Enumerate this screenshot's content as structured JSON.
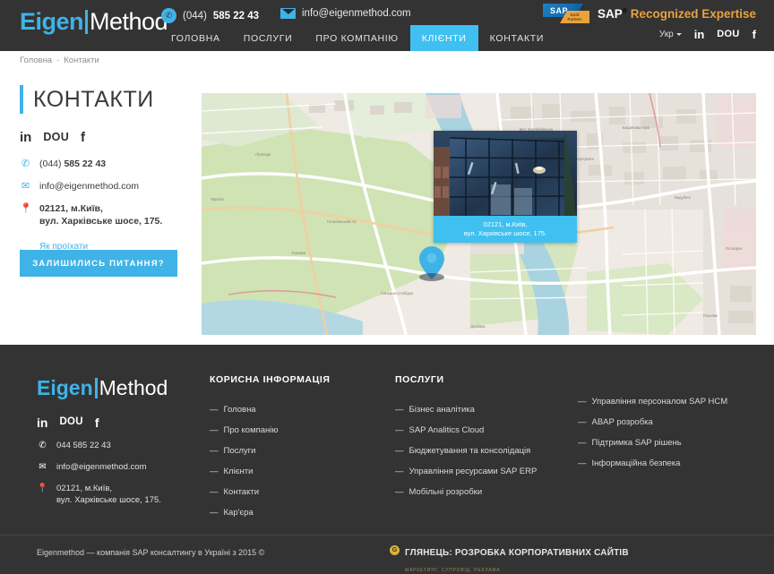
{
  "header": {
    "logo": {
      "part1": "Eigen",
      "part2": "Method"
    },
    "phone": {
      "icon": "phone-icon",
      "prefix": "(044)",
      "number": "585 22 43"
    },
    "email": {
      "icon": "mail-icon",
      "value": "info@eigenmethod.com"
    },
    "nav": [
      {
        "label": "ГОЛОВНА",
        "active": false
      },
      {
        "label": "ПОСЛУГИ",
        "active": false
      },
      {
        "label": "ПРО КОМПАНІЮ",
        "active": false
      },
      {
        "label": "КЛІЄНТИ",
        "active": true
      },
      {
        "label": "КОНТАКТИ",
        "active": false
      }
    ],
    "sap_badge": {
      "logo_text": "SAP",
      "ribbon_line1": "Gold",
      "ribbon_line2": "Partner",
      "text_white": "SAP",
      "text_sup": "®",
      "text_gold": "Recognized Expertise"
    },
    "lang": {
      "label": "Укр",
      "icon": "chevron-down-icon"
    },
    "social": [
      {
        "name": "linkedin-icon",
        "label": "in"
      },
      {
        "name": "dou-icon",
        "label": "DOU"
      },
      {
        "name": "facebook-icon",
        "label": "f"
      }
    ]
  },
  "breadcrumb": {
    "home": "Головна",
    "sep": "-",
    "current": "Контакти"
  },
  "main": {
    "title": "КОНТАКТИ",
    "social": [
      {
        "name": "linkedin-icon",
        "label": "in"
      },
      {
        "name": "dou-icon",
        "label": "DOU"
      },
      {
        "name": "facebook-icon",
        "label": "f"
      }
    ],
    "contacts": {
      "phone_prefix": "(044) ",
      "phone_number": "585 22 43",
      "email": "info@eigenmethod.com",
      "address_line1": "02121, м.Київ,",
      "address_line2": "вул. Харківське шосе, 175.",
      "directions_link": "Як проїхати"
    },
    "cta_button": "ЗАЛИШИЛИСЬ ПИТАННЯ?",
    "map": {
      "card_line1": "02121, м.Київ,",
      "card_line2": "вул. Харківське шосе, 175.",
      "pin": "map-marker-icon"
    }
  },
  "footer": {
    "logo": {
      "part1": "Eigen",
      "part2": "Method"
    },
    "social": [
      {
        "name": "linkedin-icon",
        "label": "in"
      },
      {
        "name": "dou-icon",
        "label": "DOU"
      },
      {
        "name": "facebook-icon",
        "label": "f"
      }
    ],
    "contacts": {
      "phone": "044 585 22 43",
      "email": "info@eigenmethod.com",
      "address_line1": "02121, м.Київ,",
      "address_line2": "вул. Харківське шосе, 175."
    },
    "col_useful": {
      "heading": "КОРИСНА ІНФОРМАЦІЯ",
      "items": [
        "Головна",
        "Про компанію",
        "Послуги",
        "Клієнти",
        "Контакти",
        "Кар'єра"
      ]
    },
    "col_services": {
      "heading": "ПОСЛУГИ",
      "items": [
        "Бізнес аналітика",
        "SAP Analitics Cloud",
        "Бюджетування та консолідація",
        "Управління ресурсами SAP ERP",
        "Мобільні розробки"
      ]
    },
    "col_services2": {
      "items": [
        "Управління персоналом SAP HCM",
        "ABAP розробка",
        "Підтримка SAP рішень",
        "Інформаційна безпека"
      ]
    },
    "copyright": "Eigenmethod — компанія SAP консалтингу в Україні з 2015 ©",
    "developer": {
      "title": "ГЛЯНЕЦЬ: РОЗРОБКА КОРПОРАТИВНИХ САЙТІВ",
      "subtitle": "МАРКЕТИНГ, СУПРОВІД, РЕКЛАМА"
    }
  },
  "colors": {
    "accent": "#3fb3e8",
    "accent_bright": "#3fc0f0",
    "dark": "#333333",
    "gold": "#e8a33d"
  }
}
